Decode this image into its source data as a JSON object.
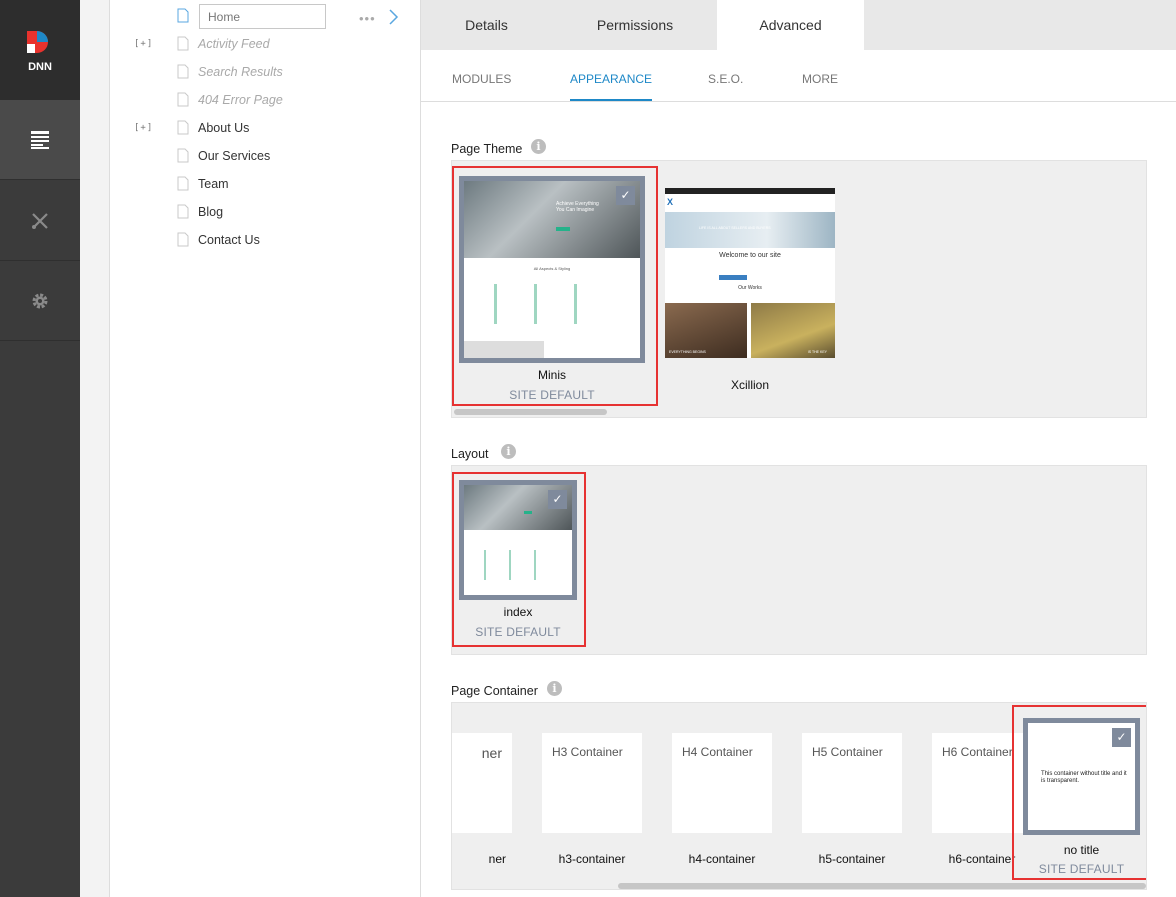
{
  "rail": {
    "logo_text": "DNN"
  },
  "tree": {
    "home_value": "Home",
    "items": [
      {
        "label": "Activity Feed",
        "disabled": true,
        "expander": "[+]"
      },
      {
        "label": "Search Results",
        "disabled": true,
        "expander": ""
      },
      {
        "label": "404 Error Page",
        "disabled": true,
        "expander": ""
      },
      {
        "label": "About Us",
        "disabled": false,
        "expander": "[+]"
      },
      {
        "label": "Our Services",
        "disabled": false,
        "expander": ""
      },
      {
        "label": "Team",
        "disabled": false,
        "expander": ""
      },
      {
        "label": "Blog",
        "disabled": false,
        "expander": ""
      },
      {
        "label": "Contact Us",
        "disabled": false,
        "expander": ""
      }
    ]
  },
  "tabs": [
    "Details",
    "Permissions",
    "Advanced"
  ],
  "subtabs": [
    "MODULES",
    "APPEARANCE",
    "S.E.O.",
    "MORE"
  ],
  "theme": {
    "title": "Page Theme",
    "items": [
      {
        "name": "Minis",
        "sub": "SITE DEFAULT",
        "selected": true
      },
      {
        "name": "Xcillion",
        "sub": "",
        "selected": false
      }
    ],
    "thumb_minis": {
      "headline": "Achieve Everything You Can Imagine",
      "section": "All Aspects & Styling"
    },
    "thumb_xcillion": {
      "banner": "LIFE IS ALL ABOUT SELLERS AND BUYERS",
      "welcome": "Welcome to our site",
      "works": "Our Works",
      "cap1": "EVERYTHING BEGINS",
      "cap2": "IS THE KEY"
    }
  },
  "layout": {
    "title": "Layout",
    "items": [
      {
        "name": "index",
        "sub": "SITE DEFAULT",
        "selected": true
      }
    ]
  },
  "container": {
    "title": "Page Container",
    "items": [
      {
        "box": "ner",
        "name": "ner"
      },
      {
        "box": "H3 Container",
        "name": "h3-container"
      },
      {
        "box": "H4 Container",
        "name": "h4-container"
      },
      {
        "box": "H5 Container",
        "name": "h5-container"
      },
      {
        "box": "H6 Container",
        "name": "h6-container"
      }
    ],
    "selected": {
      "name": "no title",
      "sub": "SITE DEFAULT",
      "box_text": "This container without title and it is transparent."
    }
  }
}
